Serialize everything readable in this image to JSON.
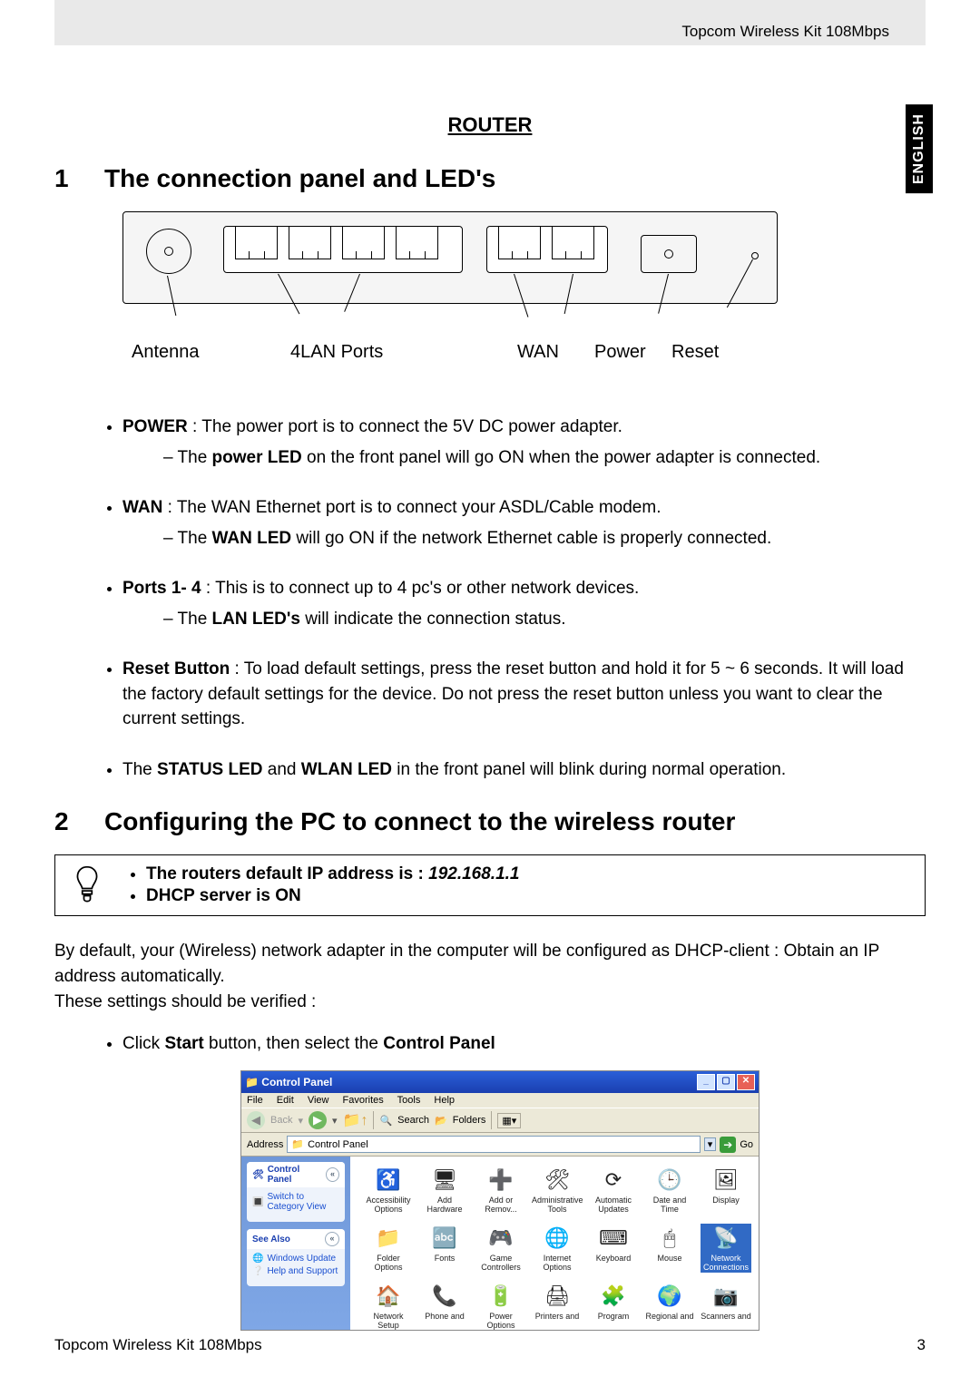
{
  "header": {
    "product": "Topcom Wireless Kit 108Mbps"
  },
  "lang_tab": "ENGLISH",
  "router_title": "ROUTER",
  "section1": {
    "num": "1",
    "title": "The connection panel and LED's"
  },
  "diagram_labels": {
    "antenna": "Antenna",
    "lan": "4LAN Ports",
    "wan": "WAN",
    "power": "Power",
    "reset": "Reset"
  },
  "bullets1": {
    "power_b": "POWER",
    "power_t": " : The power port is to connect the 5V DC power adapter.",
    "power_sub_pre": "The ",
    "power_sub_b": "power LED",
    "power_sub_post": " on the front panel will go ON when the power adapter is connected.",
    "wan_b": "WAN",
    "wan_t": "  : The WAN Ethernet port is to connect your ASDL/Cable modem.",
    "wan_sub_pre": "The ",
    "wan_sub_b": "WAN LED",
    "wan_sub_post": " will go ON if the network Ethernet cable is properly connected.",
    "ports_b": "Ports 1- 4",
    "ports_t": " : This is to connect up to 4 pc's or other network devices.",
    "ports_sub_pre": "The ",
    "ports_sub_b": "LAN LED's",
    "ports_sub_post": " will indicate the connection status.",
    "reset_b": "Reset Button",
    "reset_t": " : To load default settings, press the reset button and hold it for 5 ~ 6 seconds. It will load the factory default settings for the device. Do not press the reset button unless you want to clear the current settings.",
    "status_pre": "The ",
    "status_b1": "STATUS LED",
    "status_mid": " and ",
    "status_b2": "WLAN LED",
    "status_post": " in the front panel will blink during normal operation."
  },
  "section2": {
    "num": "2",
    "title": "Configuring the PC to connect to the wireless router"
  },
  "note": {
    "line1_pre": "The routers default IP address is : ",
    "line1_ip": "192.168.1.1",
    "line2": "DHCP server is ON"
  },
  "para1": "By default, your (Wireless) network adapter in the computer will be configured as DHCP-client : Obtain an IP address automatically.",
  "para2": "These settings should be verified :",
  "click_start_pre": "Click ",
  "click_start_b1": "Start",
  "click_start_mid": " button,  then select the ",
  "click_start_b2": "Control Panel",
  "screenshot": {
    "title": "Control Panel",
    "menus": [
      "File",
      "Edit",
      "View",
      "Favorites",
      "Tools",
      "Help"
    ],
    "toolbar": {
      "back": "Back",
      "search": "Search",
      "folders": "Folders"
    },
    "address_label": "Address",
    "address_value": "Control Panel",
    "go": "Go",
    "side": {
      "block1_title": "Control Panel",
      "block1_link": "Switch to Category View",
      "block2_title": "See Also",
      "block2_links": [
        "Windows Update",
        "Help and Support"
      ]
    },
    "icons": [
      "Accessibility Options",
      "Add Hardware",
      "Add or Remov...",
      "Administrative Tools",
      "Automatic Updates",
      "Date and Time",
      "Display",
      "Folder Options",
      "Fonts",
      "Game Controllers",
      "Internet Options",
      "Keyboard",
      "Mouse",
      "Network Connections",
      "Network Setup",
      "Phone and",
      "Power Options",
      "Printers and",
      "Program",
      "Regional and",
      "Scanners and"
    ],
    "selected_index": 13
  },
  "footer": {
    "left": "Topcom Wireless Kit 108Mbps",
    "right": "3"
  }
}
